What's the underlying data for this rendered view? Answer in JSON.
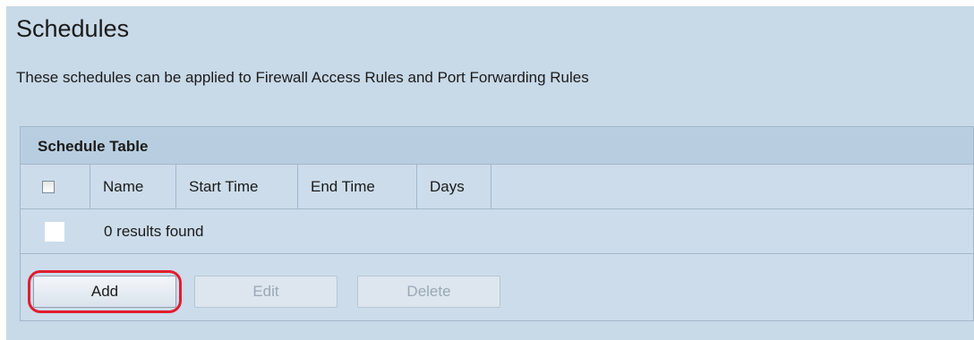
{
  "page": {
    "title": "Schedules",
    "description": "These schedules can be applied to Firewall Access Rules and Port Forwarding Rules"
  },
  "schedule_table": {
    "title": "Schedule Table",
    "columns": [
      "Name",
      "Start Time",
      "End Time",
      "Days"
    ],
    "empty_message": "0 results found"
  },
  "buttons": {
    "add": "Add",
    "edit": "Edit",
    "delete": "Delete"
  },
  "colors": {
    "background": "#c8d9e8",
    "highlight": "#e11d2e"
  }
}
